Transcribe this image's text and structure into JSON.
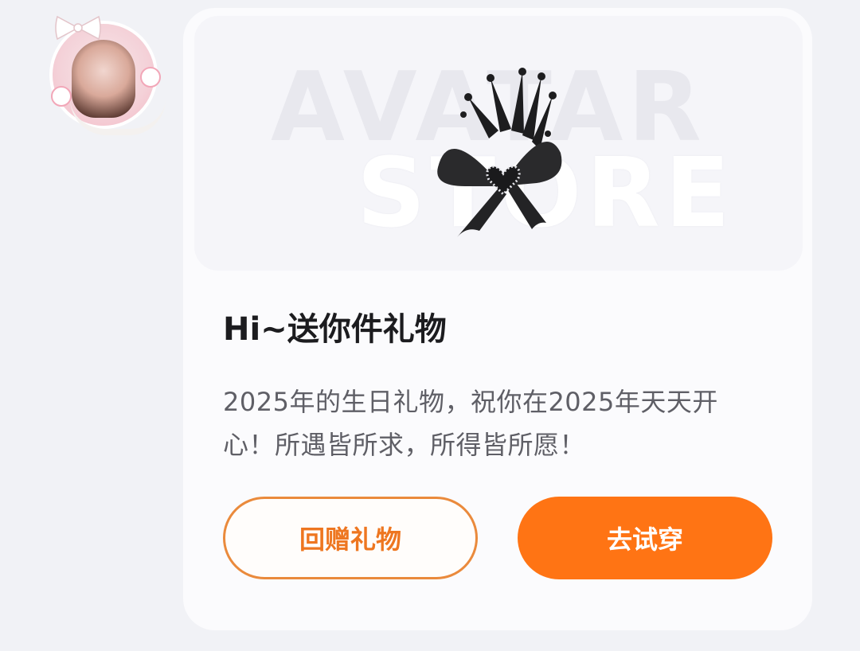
{
  "gift_card": {
    "banner": {
      "watermark_line1": "AVATAR",
      "watermark_line2": "STORE",
      "item_icon": "crown-bow-hairclip"
    },
    "title": "Hi~送你件礼物",
    "message_line1": "2025年的生日礼物，祝你在2025年天天开",
    "message_line2": "心！所遇皆所求，所得皆所愿！",
    "buttons": {
      "return_gift_label": "回赠礼物",
      "try_on_label": "去试穿"
    }
  },
  "sender": {
    "avatar_icon": "user-avatar-cat-frame"
  },
  "colors": {
    "accent": "#ff7414",
    "accent_border": "#ea8a3c",
    "background": "#f1f2f6",
    "card": "#fbfbfd"
  }
}
